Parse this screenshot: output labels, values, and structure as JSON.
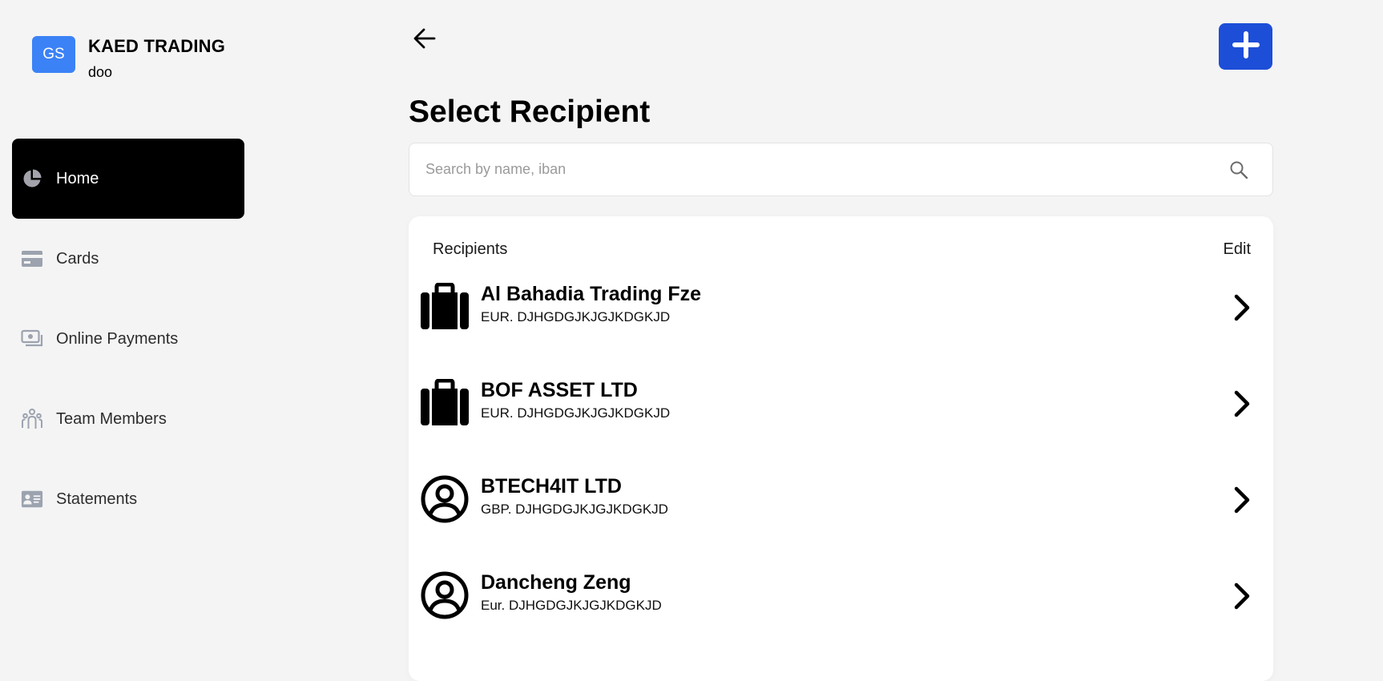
{
  "brand": {
    "avatar_initials": "GS",
    "name": "KAED TRADING",
    "sub": "doo",
    "avatar_color": "#3b82f6"
  },
  "sidebar": {
    "items": [
      {
        "label": "Home",
        "icon": "pie-chart-icon",
        "active": true
      },
      {
        "label": "Cards",
        "icon": "card-icon",
        "active": false
      },
      {
        "label": "Online Payments",
        "icon": "cash-icon",
        "active": false
      },
      {
        "label": "Team Members",
        "icon": "team-icon",
        "active": false
      },
      {
        "label": "Statements",
        "icon": "id-card-icon",
        "active": false
      }
    ]
  },
  "header": {
    "back_icon": "arrow-left-icon",
    "add_icon": "plus-icon",
    "add_color": "#1d4ed8"
  },
  "main": {
    "title": "Select Recipient",
    "search": {
      "placeholder": "Search by name, iban",
      "value": "",
      "icon": "search-icon"
    },
    "recipients": {
      "heading": "Recipients",
      "edit_label": "Edit",
      "items": [
        {
          "name": "Al Bahadia Trading Fze",
          "iban": "EUR. DJHGDGJKJGJKDGKJD",
          "icon": "briefcase-icon"
        },
        {
          "name": "BOF ASSET LTD",
          "iban": "EUR. DJHGDGJKJGJKDGKJD",
          "icon": "briefcase-icon"
        },
        {
          "name": "BTECH4IT LTD",
          "iban": "GBP. DJHGDGJKJGJKDGKJD",
          "icon": "user-circle-icon"
        },
        {
          "name": "Dancheng Zeng",
          "iban": "Eur. DJHGDGJKJGJKDGKJD",
          "icon": "user-circle-icon"
        }
      ]
    }
  }
}
